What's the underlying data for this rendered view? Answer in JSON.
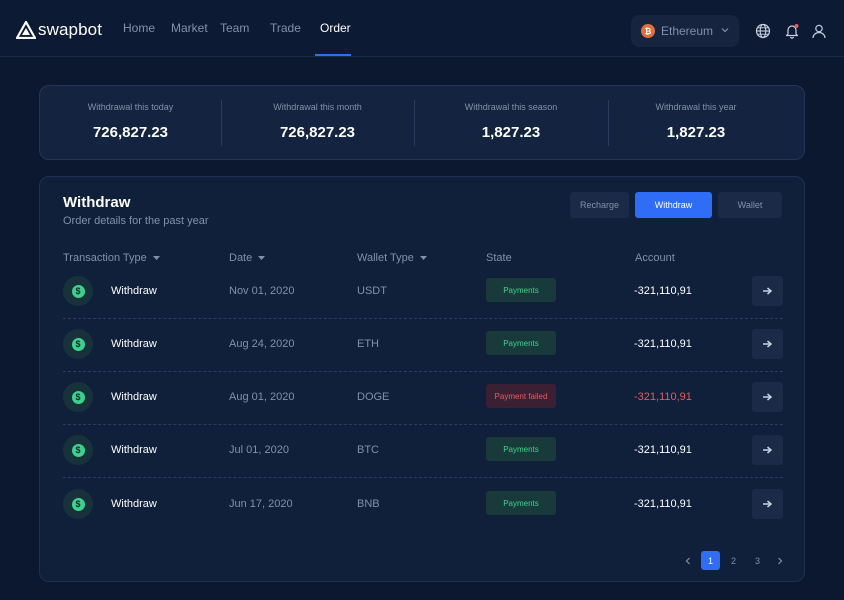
{
  "app": {
    "brand": "swapbot"
  },
  "nav": {
    "items": [
      {
        "label": "Home"
      },
      {
        "label": "Market"
      },
      {
        "label": "Team"
      },
      {
        "label": "Trade"
      },
      {
        "label": "Order",
        "active": true
      }
    ]
  },
  "currency": {
    "selected": "Ethereum",
    "coin_symbol": "₿"
  },
  "header_icons": [
    "globe-icon",
    "bell-icon",
    "user-icon"
  ],
  "stats": [
    {
      "label": "Withdrawal this today",
      "value": "726,827.23"
    },
    {
      "label": "Withdrawal this month",
      "value": "726,827.23"
    },
    {
      "label": "Withdrawal this season",
      "value": "1,827.23"
    },
    {
      "label": "Withdrawal this year",
      "value": "1,827.23"
    }
  ],
  "panel": {
    "title": "Withdraw",
    "subtitle": "Order details for the past year",
    "tabs": [
      {
        "label": "Recharge"
      },
      {
        "label": "Withdraw",
        "active": true
      },
      {
        "label": "Wallet"
      }
    ],
    "columns": [
      {
        "label": "Transaction Type",
        "sortable": true
      },
      {
        "label": "Date",
        "sortable": true
      },
      {
        "label": "Wallet Type",
        "sortable": true
      },
      {
        "label": "State",
        "sortable": false
      },
      {
        "label": "Account",
        "sortable": false
      }
    ],
    "rows": [
      {
        "type": "Withdraw",
        "date": "Nov 01, 2020",
        "wallet": "USDT",
        "state": "Payments",
        "status": "ok",
        "amount": "-321,110,91"
      },
      {
        "type": "Withdraw",
        "date": "Aug 24, 2020",
        "wallet": "ETH",
        "state": "Payments",
        "status": "ok",
        "amount": "-321,110,91"
      },
      {
        "type": "Withdraw",
        "date": "Aug 01, 2020",
        "wallet": "DOGE",
        "state": "Payment failed",
        "status": "fail",
        "amount": "-321,110,91"
      },
      {
        "type": "Withdraw",
        "date": "Jul 01, 2020",
        "wallet": "BTC",
        "state": "Payments",
        "status": "ok",
        "amount": "-321,110,91"
      },
      {
        "type": "Withdraw",
        "date": "Jun 17, 2020",
        "wallet": "BNB",
        "state": "Payments",
        "status": "ok",
        "amount": "-321,110,91"
      }
    ],
    "row_icon": "dollar-icon",
    "row_icon_glyph": "$"
  },
  "pagination": {
    "pages": [
      "1",
      "2",
      "3"
    ],
    "current": "1"
  },
  "colors": {
    "accent": "#2f6df6",
    "success": "#3bd28b",
    "danger": "#e55c5c",
    "background": "#0b1830"
  }
}
